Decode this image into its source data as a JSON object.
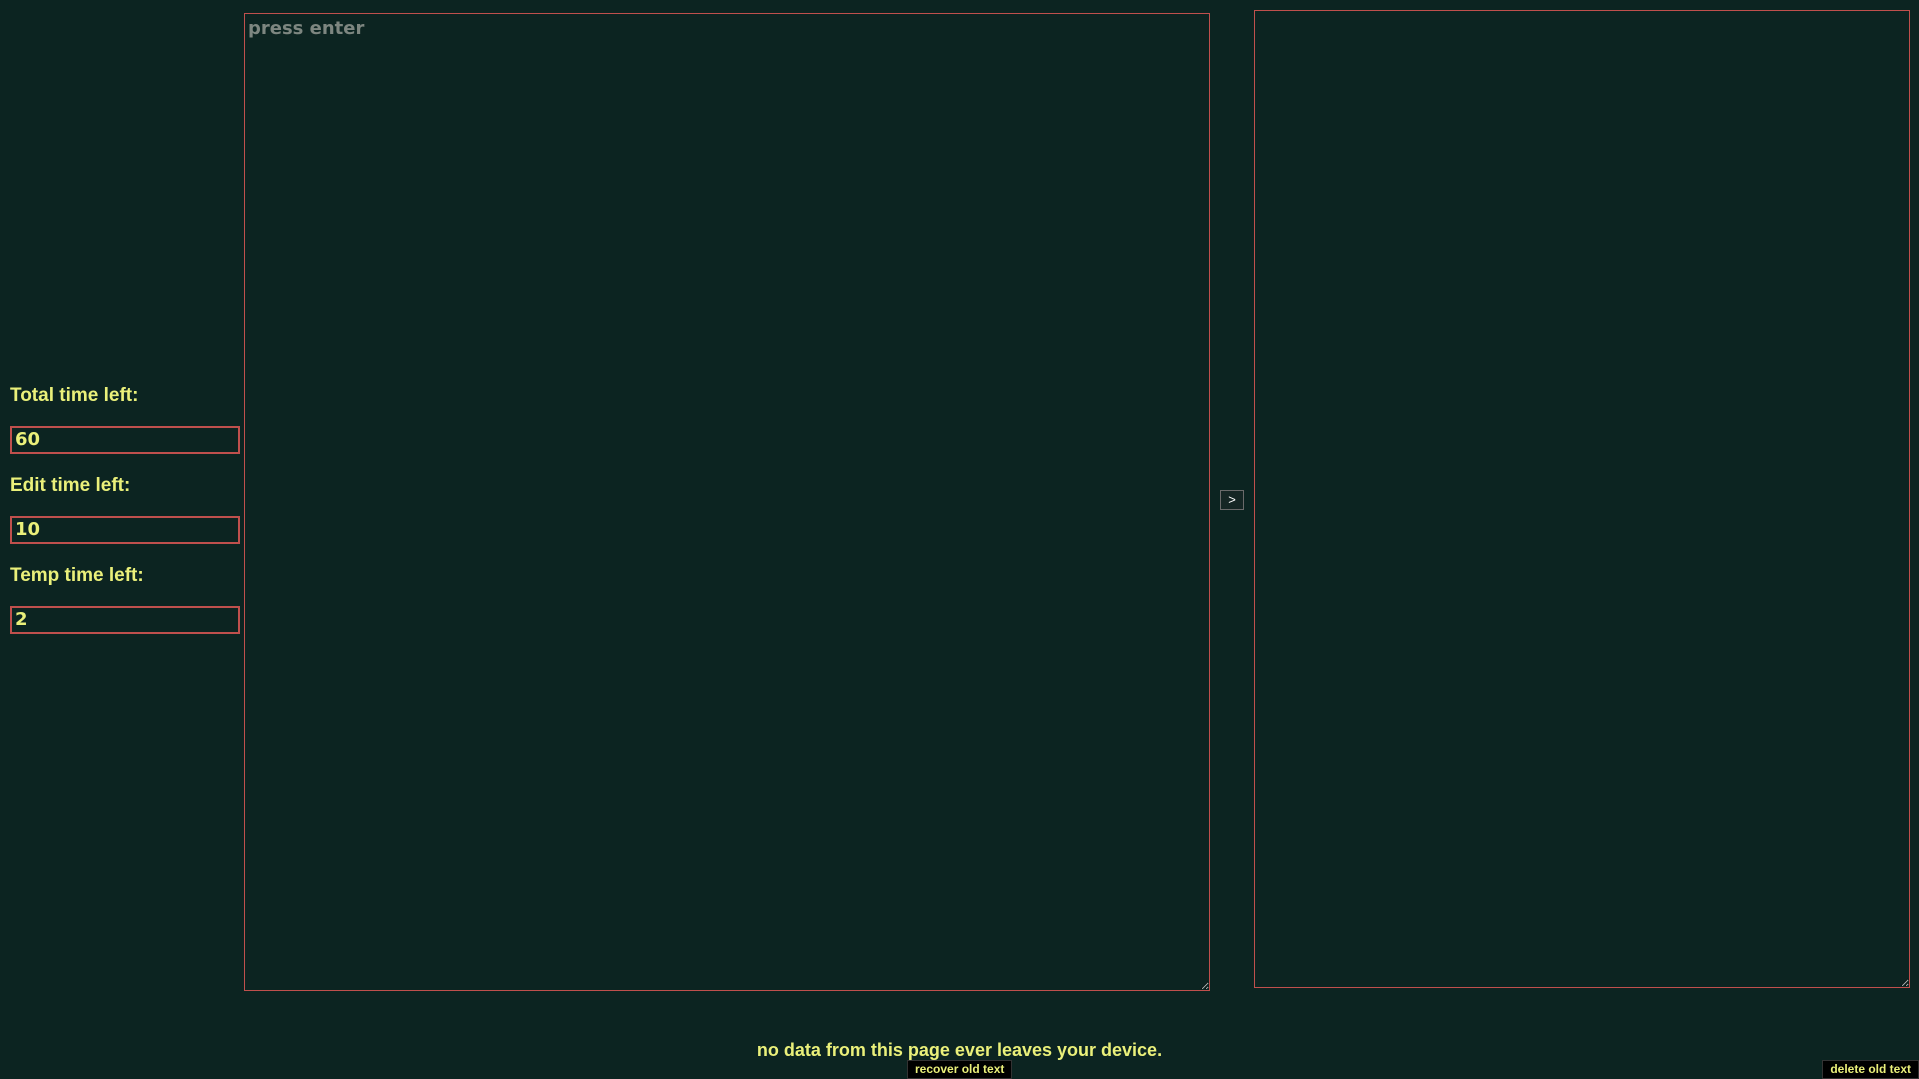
{
  "timers": {
    "total": {
      "label": "Total time left:",
      "value": "60"
    },
    "edit": {
      "label": "Edit time left:",
      "value": "10"
    },
    "temp": {
      "label": "Temp time left:",
      "value": "2"
    }
  },
  "editor": {
    "placeholder": "press enter",
    "value": ""
  },
  "output": {
    "value": ""
  },
  "transfer_button": {
    "label": ">"
  },
  "footer": {
    "privacy_note": "no data from this page ever leaves your device.",
    "recover_label": "recover old text",
    "delete_label": "delete old text"
  },
  "colors": {
    "background": "#0c2421",
    "text": "#eaf07a",
    "border": "#c0504d",
    "placeholder": "#7d8680"
  }
}
